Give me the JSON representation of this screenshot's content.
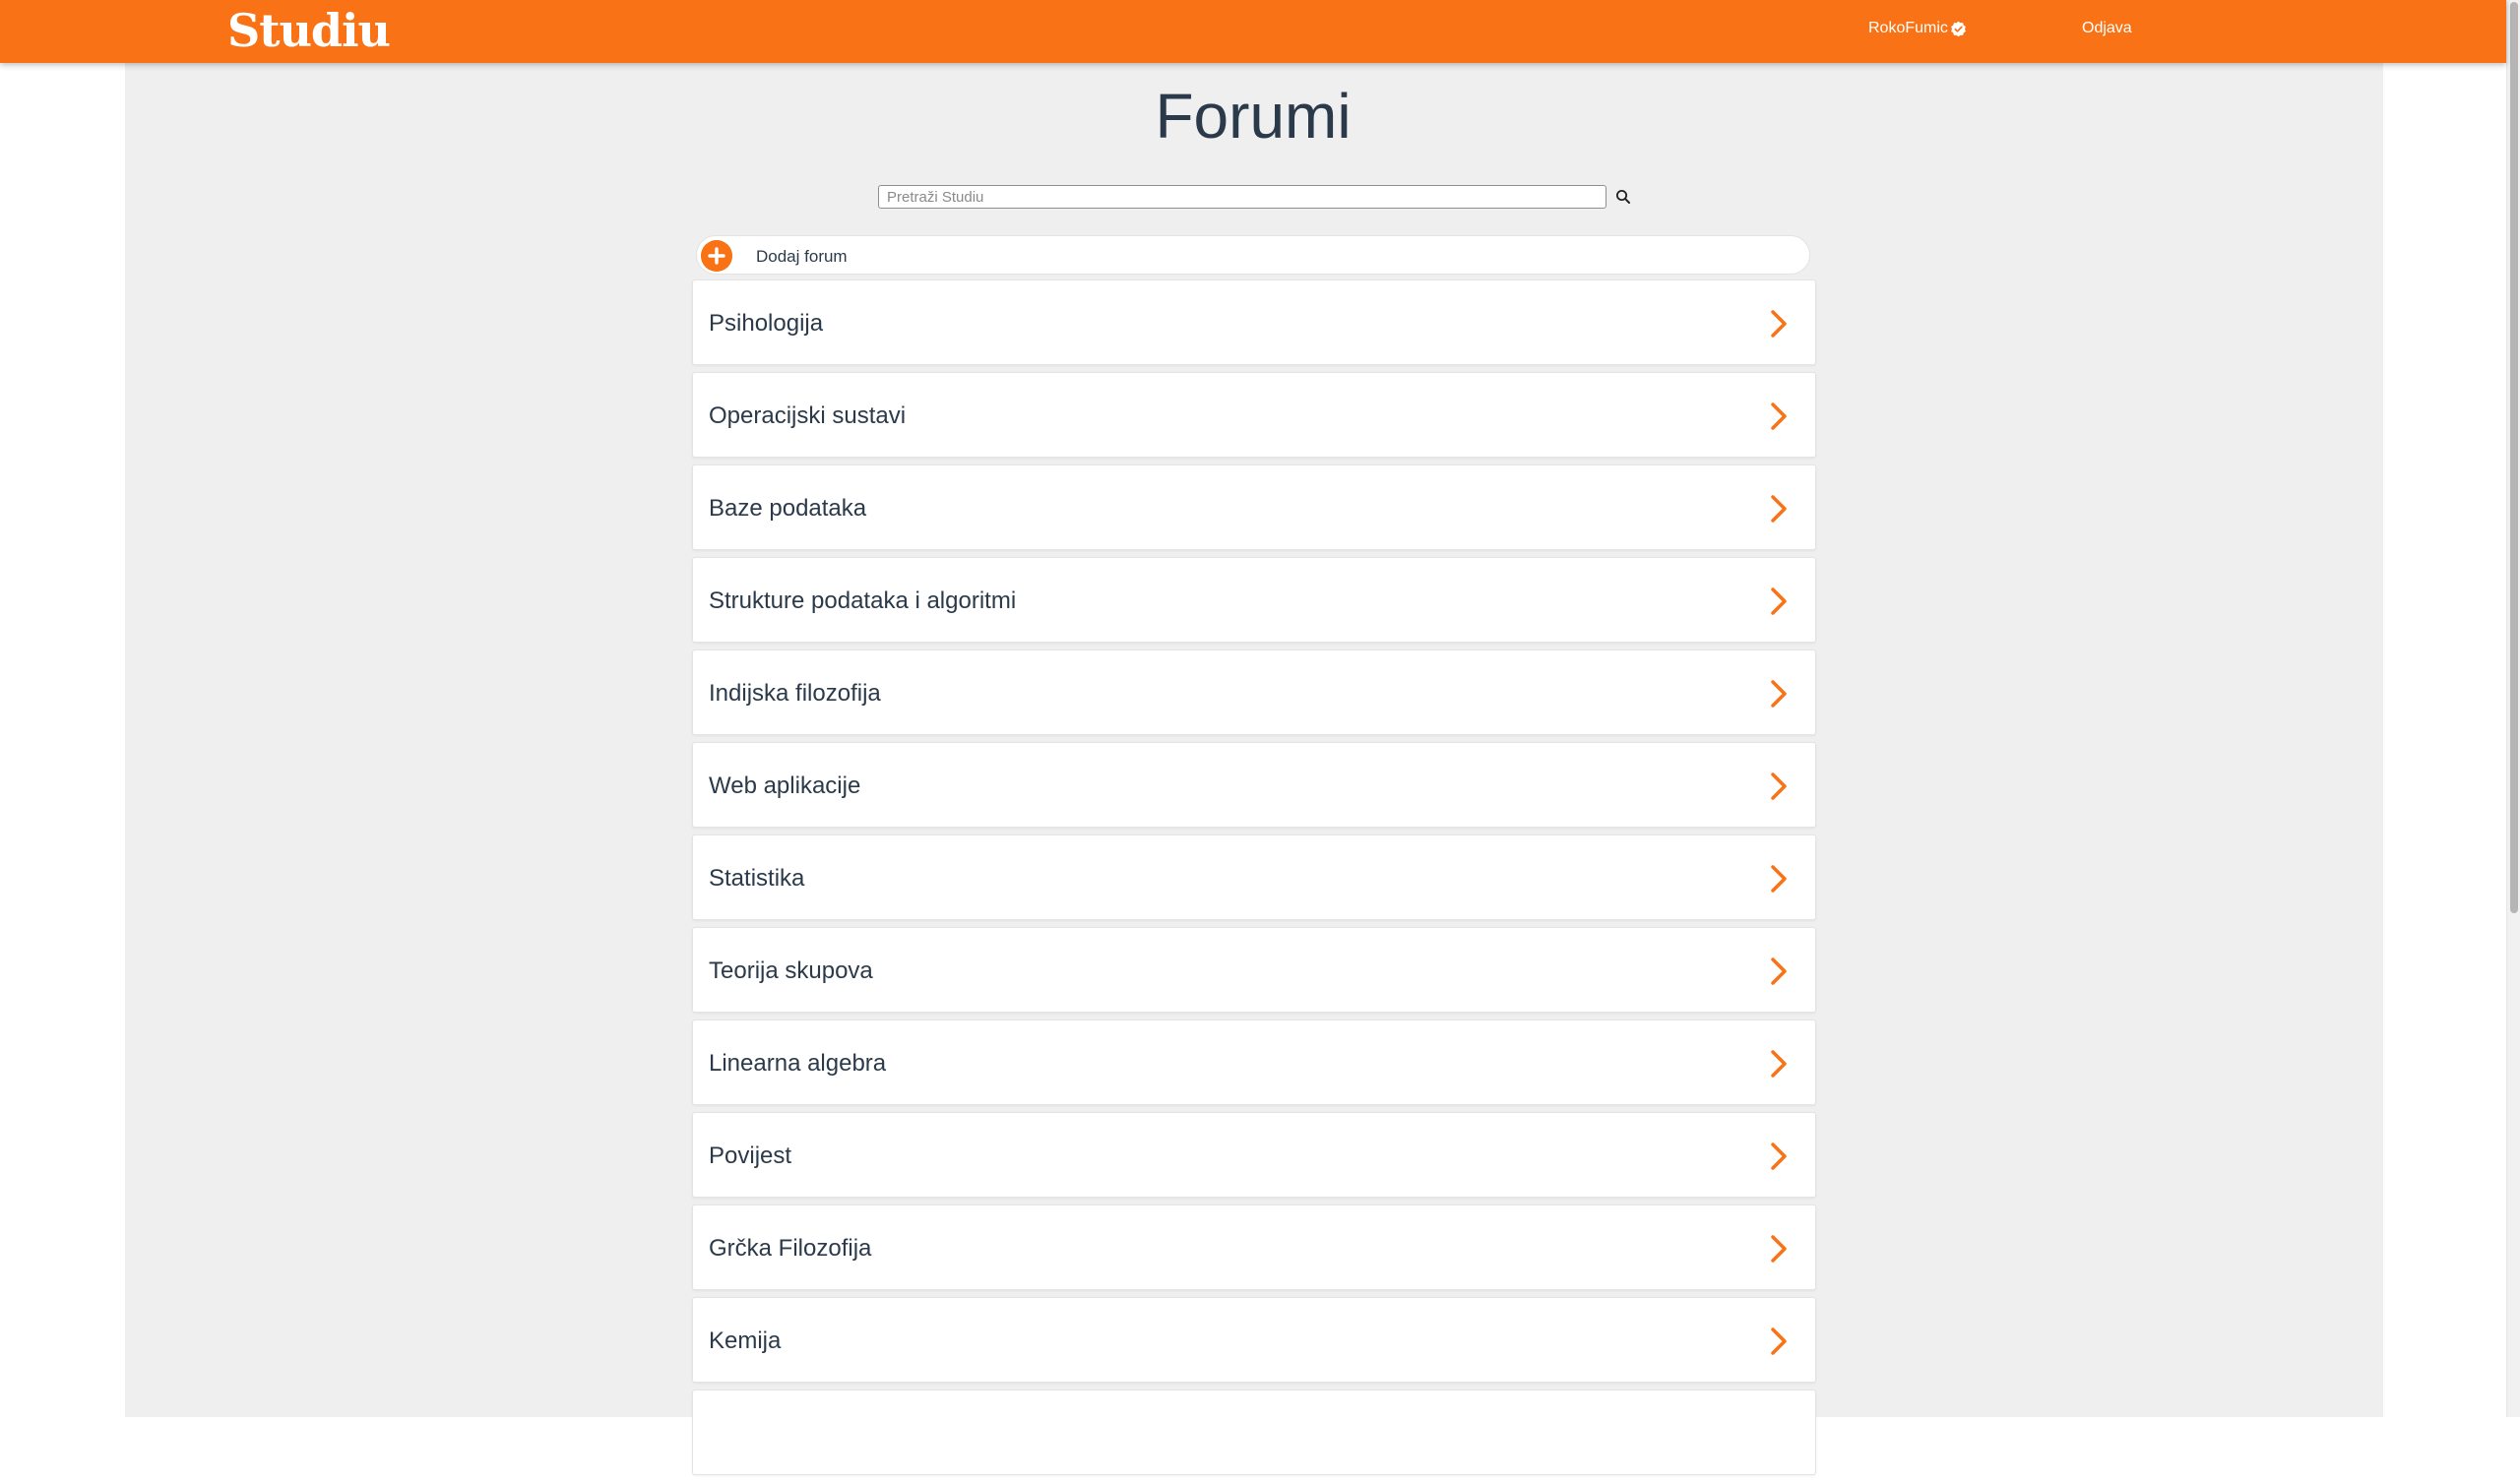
{
  "header": {
    "logo": "Studiu",
    "username": "RokoFumic",
    "logout_label": "Odjava"
  },
  "page": {
    "title": "Forumi"
  },
  "search": {
    "placeholder": "Pretraži Studiu"
  },
  "add_forum": {
    "label": "Dodaj forum"
  },
  "forums": [
    {
      "label": "Psihologija"
    },
    {
      "label": "Operacijski sustavi"
    },
    {
      "label": "Baze podataka"
    },
    {
      "label": "Strukture podataka i algoritmi"
    },
    {
      "label": "Indijska filozofija"
    },
    {
      "label": "Web aplikacije"
    },
    {
      "label": "Statistika"
    },
    {
      "label": "Teorija skupova"
    },
    {
      "label": "Linearna algebra"
    },
    {
      "label": "Povijest"
    },
    {
      "label": "Grčka Filozofija"
    },
    {
      "label": "Kemija"
    },
    {
      "label": ""
    }
  ],
  "colors": {
    "accent": "#f97316",
    "text": "#2b3a4a",
    "panel_background": "#efefef"
  },
  "icons": {
    "verified": "verified-badge-icon",
    "search": "search-icon",
    "add": "plus-icon",
    "forum_arrow": "chevron-right-icon"
  }
}
